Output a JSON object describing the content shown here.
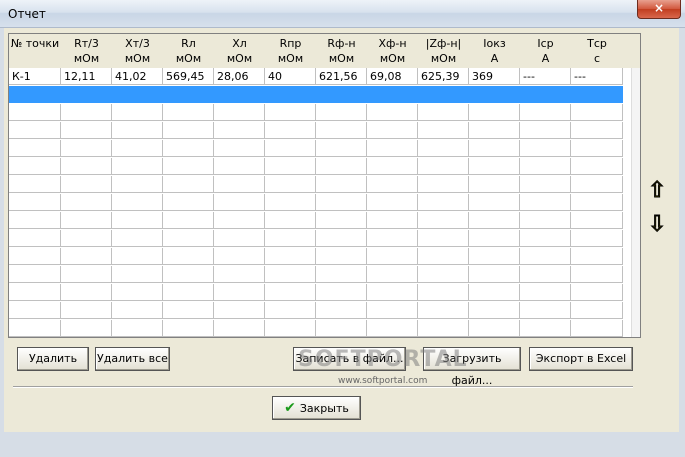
{
  "window": {
    "title": "Отчет",
    "close_glyph": "×"
  },
  "table": {
    "headers": [
      {
        "l1": "№ точки",
        "l2": ""
      },
      {
        "l1": "Rт/3",
        "l2": "мОм"
      },
      {
        "l1": "Xт/3",
        "l2": "мОм"
      },
      {
        "l1": "Rл",
        "l2": "мОм"
      },
      {
        "l1": "Xл",
        "l2": "мОм"
      },
      {
        "l1": "Rпр",
        "l2": "мОм"
      },
      {
        "l1": "Rф-н",
        "l2": "мОм"
      },
      {
        "l1": "Xф-н",
        "l2": "мОм"
      },
      {
        "l1": "|Zф-н|",
        "l2": "мОм"
      },
      {
        "l1": "Iокз",
        "l2": "А"
      },
      {
        "l1": "Iср",
        "l2": "А"
      },
      {
        "l1": "Tср",
        "l2": "с"
      }
    ],
    "rows": [
      [
        "К-1",
        "12,11",
        "41,02",
        "569,45",
        "28,06",
        "40",
        "621,56",
        "69,08",
        "625,39",
        "369",
        "---",
        "---"
      ]
    ]
  },
  "buttons": {
    "delete": "Удалить",
    "delete_all": "Удалить все",
    "save_file": "Записать в файл...",
    "load_file": "Загрузить файл...",
    "export_excel": "Экспорт в Excel",
    "close": "Закрыть"
  },
  "icons": {
    "up": "arrow-up-icon",
    "down": "arrow-down-icon",
    "check": "checkmark-icon"
  },
  "watermark": {
    "text": "SOFTPORTAL",
    "url": "www.softportal.com"
  }
}
